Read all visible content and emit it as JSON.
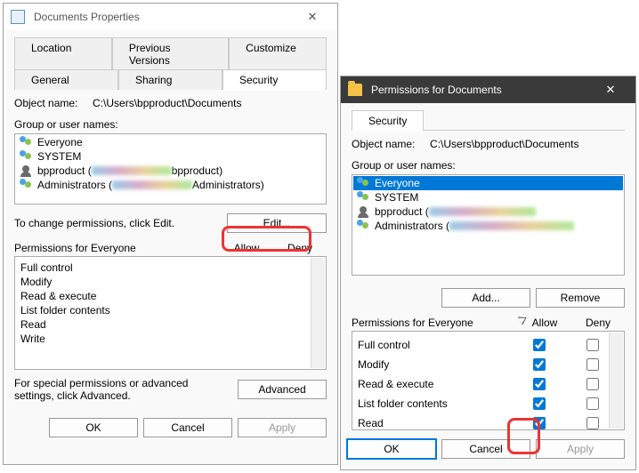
{
  "dialog1": {
    "title": "Documents Properties",
    "tabs_row1": [
      "Location",
      "Previous Versions",
      "Customize"
    ],
    "tabs_row2": [
      "General",
      "Sharing",
      "Security"
    ],
    "active_tab": "Security",
    "object_label": "Object name:",
    "object_value": "C:\\Users\\bpproduct\\Documents",
    "group_label": "Group or user names:",
    "users": [
      {
        "icon": "group",
        "text": "Everyone"
      },
      {
        "icon": "group",
        "text": "SYSTEM"
      },
      {
        "icon": "user",
        "text": "bpproduct (",
        "blur_w": 90,
        "suffix": "bpproduct)"
      },
      {
        "icon": "group",
        "text": "Administrators (",
        "blur_w": 90,
        "suffix": "Administrators)"
      }
    ],
    "edit_hint": "To change permissions, click Edit.",
    "edit_button": "Edit...",
    "perm_label": "Permissions for Everyone",
    "allow_label": "Allow",
    "deny_label": "Deny",
    "perms": [
      "Full control",
      "Modify",
      "Read & execute",
      "List folder contents",
      "Read",
      "Write"
    ],
    "adv_hint": "For special permissions or advanced settings, click Advanced.",
    "advanced_button": "Advanced",
    "ok": "OK",
    "cancel": "Cancel",
    "apply": "Apply"
  },
  "dialog2": {
    "title": "Permissions for Documents",
    "tab": "Security",
    "object_label": "Object name:",
    "object_value": "C:\\Users\\bpproduct\\Documents",
    "group_label": "Group or user names:",
    "users": [
      {
        "icon": "group",
        "text": "Everyone",
        "selected": true
      },
      {
        "icon": "group",
        "text": "SYSTEM"
      },
      {
        "icon": "user",
        "text": "bpproduct (",
        "blur_w": 120,
        "suffix": ""
      },
      {
        "icon": "group",
        "text": "Administrators (",
        "blur_w": 140,
        "suffix": ""
      }
    ],
    "add_button": "Add...",
    "remove_button": "Remove",
    "perm_label": "Permissions for Everyone",
    "allow_label": "Allow",
    "deny_label": "Deny",
    "perms": [
      {
        "name": "Full control",
        "allow": true,
        "deny": false
      },
      {
        "name": "Modify",
        "allow": true,
        "deny": false
      },
      {
        "name": "Read & execute",
        "allow": true,
        "deny": false
      },
      {
        "name": "List folder contents",
        "allow": true,
        "deny": false
      },
      {
        "name": "Read",
        "allow": true,
        "deny": false
      }
    ],
    "ok": "OK",
    "cancel": "Cancel",
    "apply": "Apply"
  }
}
